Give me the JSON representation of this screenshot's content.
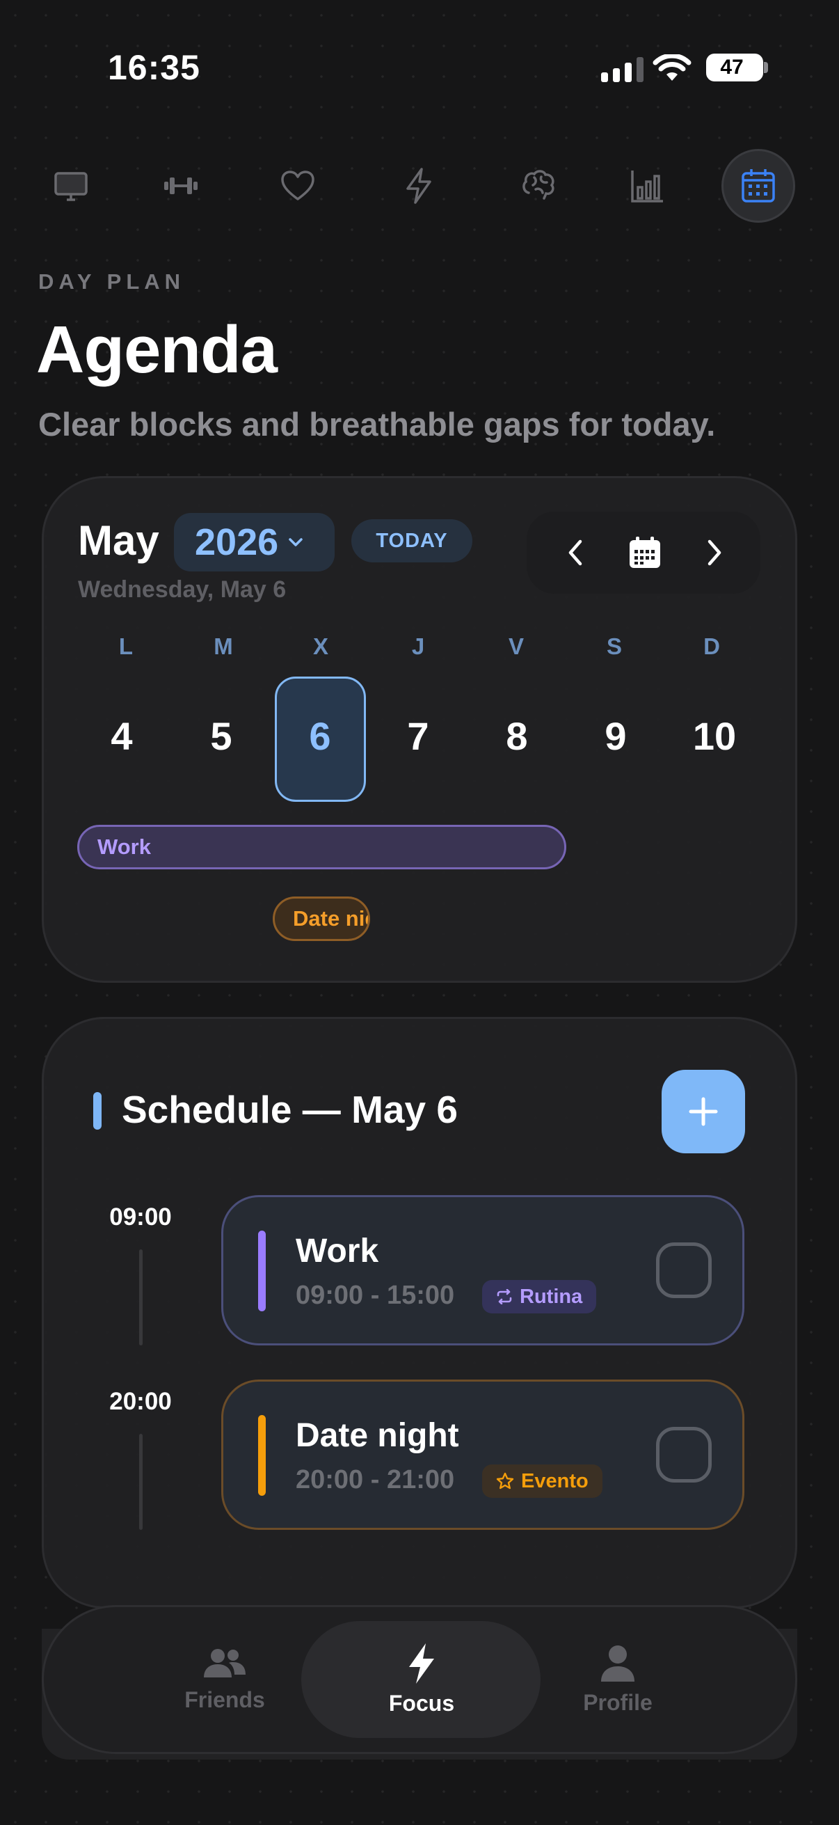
{
  "status_bar": {
    "time": "16:35",
    "battery": "47"
  },
  "top_nav": {
    "items": [
      {
        "name": "desktop",
        "icon": "monitor-icon"
      },
      {
        "name": "fitness",
        "icon": "dumbbell-icon"
      },
      {
        "name": "health",
        "icon": "heart-icon"
      },
      {
        "name": "energy",
        "icon": "bolt-icon"
      },
      {
        "name": "mind",
        "icon": "brain-icon"
      },
      {
        "name": "stats",
        "icon": "bar-chart-icon"
      },
      {
        "name": "agenda",
        "icon": "calendar-icon",
        "active": true
      }
    ]
  },
  "header": {
    "eyebrow": "DAY PLAN",
    "title": "Agenda",
    "subtitle": "Clear blocks and breathable gaps for today."
  },
  "calendar": {
    "month": "May",
    "year": "2026",
    "today_label": "TODAY",
    "date_line": "Wednesday, May 6",
    "weekdays": [
      "L",
      "M",
      "X",
      "J",
      "V",
      "S",
      "D"
    ],
    "days": [
      "4",
      "5",
      "6",
      "7",
      "8",
      "9",
      "10"
    ],
    "selected_day": "6",
    "events": [
      {
        "label": "Work",
        "color": "#b49cff"
      },
      {
        "label": "Date night",
        "visible_label": "Date nig",
        "color": "#f59e2a"
      }
    ]
  },
  "schedule": {
    "title": "Schedule — May 6",
    "add_icon": "plus-icon",
    "entries": [
      {
        "time": "09:00",
        "title": "Work",
        "range": "09:00 - 15:00",
        "tag": "Rutina",
        "tag_icon": "repeat-icon",
        "color": "#9a7cff"
      },
      {
        "time": "20:00",
        "title": "Date night",
        "range": "20:00 - 21:00",
        "tag": "Evento",
        "tag_icon": "star-icon",
        "color": "#f59e0b"
      }
    ]
  },
  "tab_bar": {
    "items": [
      {
        "label": "Friends",
        "icon": "friends-icon"
      },
      {
        "label": "Focus",
        "icon": "bolt-icon",
        "active": true
      },
      {
        "label": "Profile",
        "icon": "person-icon"
      }
    ]
  }
}
